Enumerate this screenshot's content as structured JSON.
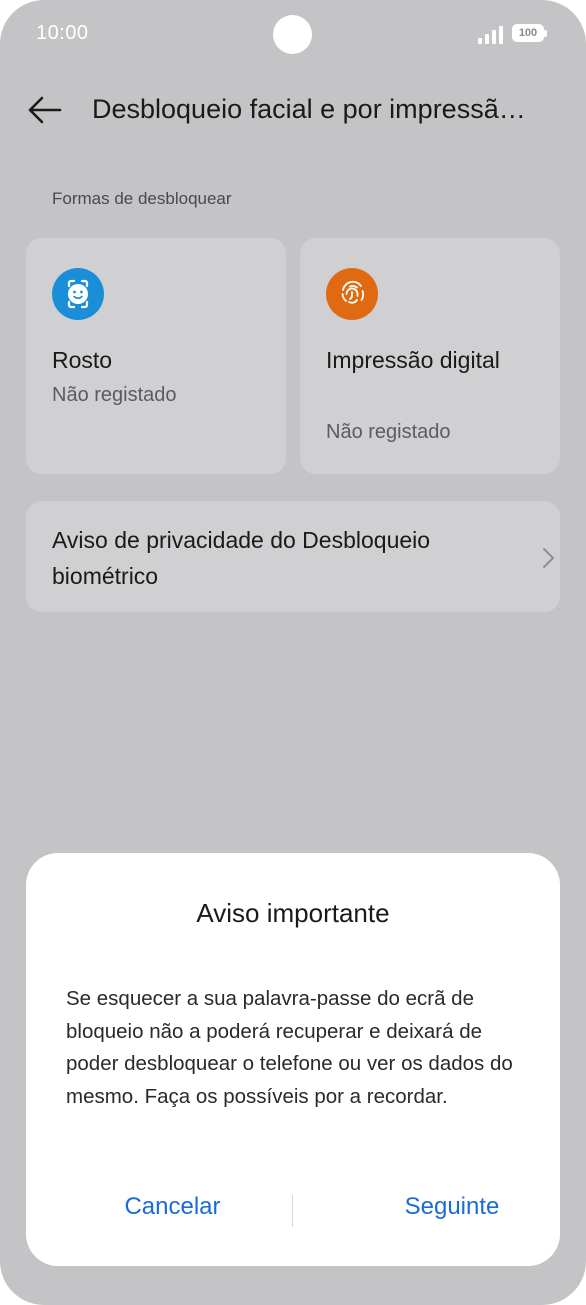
{
  "status_bar": {
    "time": "10:00",
    "battery": "100"
  },
  "header": {
    "title": "Desbloqueio facial e por impressã…"
  },
  "section": {
    "label": "Formas de desbloquear"
  },
  "methods": [
    {
      "title": "Rosto",
      "status": "Não registado",
      "icon": "face-icon",
      "color": "#1a8fd8"
    },
    {
      "title": "Impressão digital",
      "status": "Não registado",
      "icon": "fingerprint-icon",
      "color": "#e06a12"
    }
  ],
  "privacy": {
    "label": "Aviso de privacidade do Desbloqueio biométrico"
  },
  "dialog": {
    "title": "Aviso importante",
    "body": "Se esquecer a sua palavra-passe do ecrã de bloqueio não a poderá recuperar e deixará de poder desbloquear o telefone ou ver os dados do mesmo. Faça os possíveis por a recordar.",
    "cancel_label": "Cancelar",
    "next_label": "Seguinte"
  },
  "colors": {
    "accent": "#1a6bd6",
    "background_dimmed": "#c4c4c6"
  }
}
